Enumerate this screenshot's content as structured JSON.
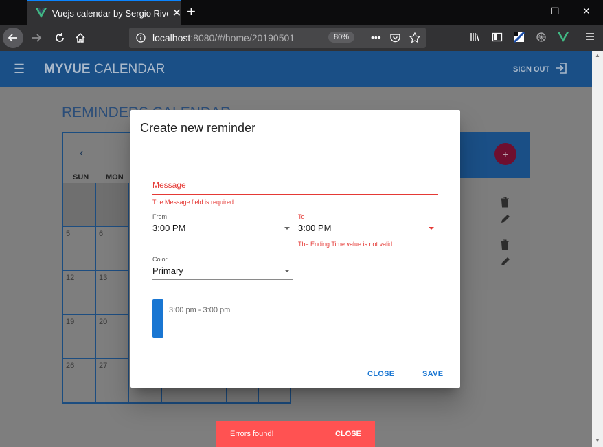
{
  "browser": {
    "tab_title": "Vuejs calendar by Sergio Rivera",
    "tab_close": "✕",
    "new_tab": "+",
    "url_host": "localhost",
    "url_rest": ":8080/#/home/20190501",
    "zoom": "80%",
    "window_controls": [
      "—",
      "☐",
      "✕"
    ]
  },
  "app": {
    "brand_bold": "MYVUE",
    "brand_light": "CALENDAR",
    "sign_out": "SIGN OUT"
  },
  "calendar": {
    "heading": "REMINDERS CALENDAR",
    "days_of_week": [
      "SUN",
      "MON"
    ],
    "dates": [
      "5",
      "6",
      "12",
      "13",
      "19",
      "20",
      "26",
      "27"
    ]
  },
  "dialog": {
    "title": "Create new reminder",
    "message_label": "Message",
    "message_error": "The Message field is required.",
    "from_label": "From",
    "from_value": "3:00 PM",
    "to_label": "To",
    "to_value": "3:00 PM",
    "to_error": "The Ending Time value is not valid.",
    "color_label": "Color",
    "color_value": "Primary",
    "preview_text": "3:00 pm - 3:00 pm",
    "close_button": "CLOSE",
    "save_button": "SAVE"
  },
  "snackbar": {
    "text": "Errors found!",
    "close": "CLOSE"
  },
  "colors": {
    "primary": "#1976d2",
    "error": "#e53935",
    "snackbar": "#ff5252",
    "appbar": "#1a4f86"
  }
}
